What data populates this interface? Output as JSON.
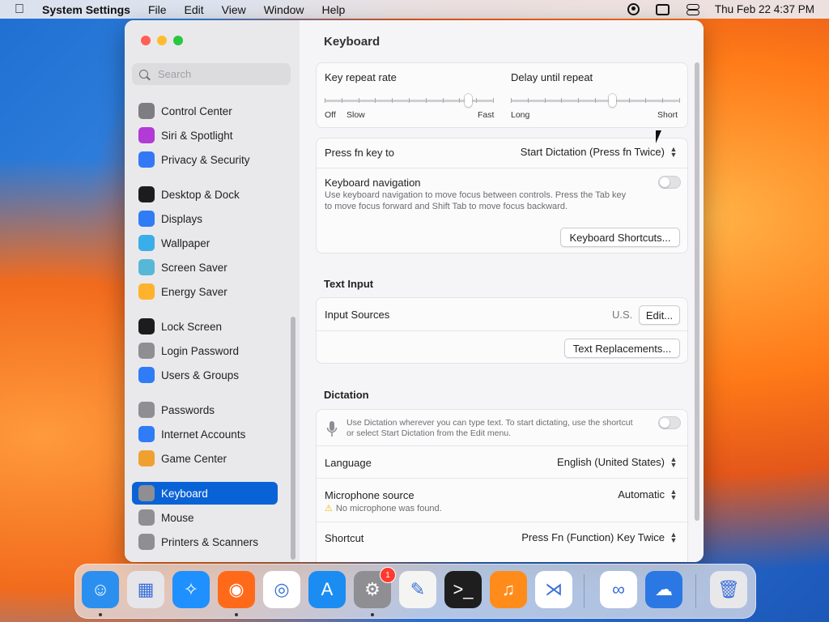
{
  "menubar": {
    "apple": "",
    "app_name": "System Settings",
    "menus": [
      "File",
      "Edit",
      "View",
      "Window",
      "Help"
    ],
    "datetime": "Thu Feb 22  4:37 PM"
  },
  "sidebar": {
    "search_placeholder": "Search",
    "items": [
      {
        "label": "Control Center",
        "icon": "control-center-icon",
        "color": "#7d7d82"
      },
      {
        "label": "Siri & Spotlight",
        "icon": "siri-icon",
        "color": "#b23ad6"
      },
      {
        "label": "Privacy & Security",
        "icon": "hand-icon",
        "color": "#3478f6"
      },
      {
        "label": "Desktop & Dock",
        "icon": "dock-icon",
        "color": "#1c1c1e"
      },
      {
        "label": "Displays",
        "icon": "sun-icon",
        "color": "#2f7cf6"
      },
      {
        "label": "Wallpaper",
        "icon": "flower-icon",
        "color": "#3aaee8"
      },
      {
        "label": "Screen Saver",
        "icon": "screensaver-icon",
        "color": "#56b8d6"
      },
      {
        "label": "Energy Saver",
        "icon": "bulb-icon",
        "color": "#ffb22c"
      },
      {
        "label": "Lock Screen",
        "icon": "lock-icon",
        "color": "#1c1c1e"
      },
      {
        "label": "Login Password",
        "icon": "lock-icon",
        "color": "#8e8e93"
      },
      {
        "label": "Users & Groups",
        "icon": "users-icon",
        "color": "#2f7cf6"
      },
      {
        "label": "Passwords",
        "icon": "key-icon",
        "color": "#8e8e93"
      },
      {
        "label": "Internet Accounts",
        "icon": "at-icon",
        "color": "#2f7cf6"
      },
      {
        "label": "Game Center",
        "icon": "game-center-icon",
        "color": "#f0a030"
      },
      {
        "label": "Keyboard",
        "icon": "keyboard-icon",
        "color": "#8e8e93"
      },
      {
        "label": "Mouse",
        "icon": "mouse-icon",
        "color": "#8e8e93"
      },
      {
        "label": "Printers & Scanners",
        "icon": "printer-icon",
        "color": "#8e8e93"
      }
    ],
    "selected_index": 14
  },
  "main": {
    "title": "Keyboard",
    "key_repeat": {
      "label": "Key repeat rate",
      "left_labels": [
        "Off",
        "Slow"
      ],
      "right_label": "Fast",
      "level": 0.85
    },
    "delay_repeat": {
      "label": "Delay until repeat",
      "left_label": "Long",
      "right_label": "Short",
      "level": 0.6
    },
    "fn_key": {
      "label": "Press fn key to",
      "value": "Start Dictation (Press fn Twice)"
    },
    "keyboard_nav": {
      "label": "Keyboard navigation",
      "desc_line1": "Use keyboard navigation to move focus between controls. Press the Tab key",
      "desc_line2": "to move focus forward and Shift Tab to move focus backward.",
      "on": false
    },
    "shortcuts_button": "Keyboard Shortcuts...",
    "text_input": {
      "section": "Text Input",
      "input_sources_label": "Input Sources",
      "input_sources_value": "U.S.",
      "edit_button": "Edit...",
      "replacements_button": "Text Replacements..."
    },
    "dictation": {
      "section": "Dictation",
      "desc_line1": "Use Dictation wherever you can type text. To start dictating, use the shortcut",
      "desc_line2": "or select Start Dictation from the Edit menu.",
      "on": false,
      "language_label": "Language",
      "language_value": "English (United States)",
      "mic_label": "Microphone source",
      "mic_value": "Automatic",
      "mic_warning": "No microphone was found.",
      "shortcut_label": "Shortcut",
      "shortcut_value": "Press Fn (Function) Key Twice"
    }
  },
  "dock": {
    "apps": [
      {
        "name": "finder-icon",
        "color": "#2b8ff0",
        "glyph": "☺",
        "running": true
      },
      {
        "name": "launchpad-icon",
        "color": "#e6e6ea",
        "glyph": "▦",
        "running": false
      },
      {
        "name": "safari-icon",
        "color": "#1e90ff",
        "glyph": "✧",
        "running": false
      },
      {
        "name": "firefox-icon",
        "color": "#ff6a1a",
        "glyph": "◉",
        "running": true
      },
      {
        "name": "chrome-icon",
        "color": "#ffffff",
        "glyph": "◎",
        "running": false
      },
      {
        "name": "app-store-icon",
        "color": "#1a8cf2",
        "glyph": "A",
        "running": false
      },
      {
        "name": "system-settings-icon",
        "color": "#8e8e93",
        "glyph": "⚙",
        "running": true,
        "badge": "1"
      },
      {
        "name": "textedit-icon",
        "color": "#f4f4f2",
        "glyph": "✎",
        "running": false
      },
      {
        "name": "terminal-icon",
        "color": "#1e1e1e",
        "glyph": ">_",
        "running": false
      },
      {
        "name": "garageband-icon",
        "color": "#ff8c1a",
        "glyph": "♫",
        "running": false
      },
      {
        "name": "vscode-icon",
        "color": "#ffffff",
        "glyph": "⋊",
        "running": false
      },
      {
        "name": "visual-studio-icon",
        "color": "#ffffff",
        "glyph": "∞",
        "running": false
      },
      {
        "name": "weather-icon",
        "color": "#2b78e4",
        "glyph": "☁",
        "running": false
      },
      {
        "name": "trash-icon",
        "color": "#e8e8ea",
        "glyph": "🗑",
        "running": false
      }
    ]
  }
}
